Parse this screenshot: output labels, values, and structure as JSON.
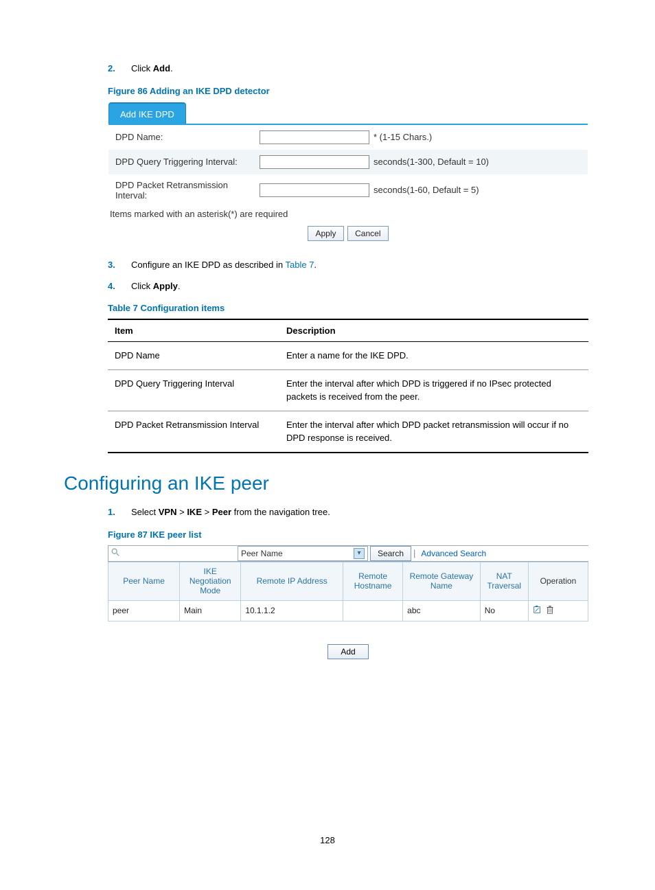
{
  "steps_a": [
    {
      "num": "2.",
      "text_pre": "Click ",
      "bold": "Add",
      "text_post": "."
    }
  ],
  "figure86": {
    "caption": "Figure 86 Adding an IKE DPD detector",
    "tab": "Add IKE DPD",
    "rows": [
      {
        "label": "DPD Name:",
        "hint": "* (1-15 Chars.)"
      },
      {
        "label": "DPD Query Triggering Interval:",
        "hint": "seconds(1-300, Default = 10)"
      },
      {
        "label": "DPD Packet Retransmission Interval:",
        "hint": "seconds(1-60, Default = 5)"
      }
    ],
    "note": "Items marked with an asterisk(*) are required",
    "apply": "Apply",
    "cancel": "Cancel"
  },
  "steps_b": [
    {
      "num": "3.",
      "text_pre": "Configure an IKE DPD as described in ",
      "link": "Table 7",
      "text_post": "."
    },
    {
      "num": "4.",
      "text_pre": "Click ",
      "bold": "Apply",
      "text_post": "."
    }
  ],
  "table7": {
    "caption": "Table 7 Configuration items",
    "col1": "Item",
    "col2": "Description",
    "rows": [
      {
        "c1": "DPD Name",
        "c2": "Enter a name for the IKE DPD."
      },
      {
        "c1": "DPD Query Triggering Interval",
        "c2": "Enter the interval after which DPD is triggered if no IPsec protected packets is received from the peer."
      },
      {
        "c1": "DPD Packet Retransmission Interval",
        "c2": "Enter the interval after which DPD packet retransmission will occur if no DPD response is received."
      }
    ]
  },
  "section_title": "Configuring an IKE peer",
  "steps_c_num": "1.",
  "steps_c_pre": "Select ",
  "steps_c_b1": "VPN",
  "steps_c_gt": " > ",
  "steps_c_b2": "IKE",
  "steps_c_b3": "Peer",
  "steps_c_post": " from the navigation tree.",
  "figure87": {
    "caption": "Figure 87 IKE peer list",
    "search_selected": "Peer Name",
    "search_btn": "Search",
    "adv": "Advanced Search",
    "headers": {
      "h1": "Peer Name",
      "h2": "IKE Negotiation Mode",
      "h3": "Remote IP Address",
      "h4": "Remote Hostname",
      "h5": "Remote Gateway Name",
      "h6": "NAT Traversal",
      "h7": "Operation"
    },
    "row": {
      "c1": "peer",
      "c2": "Main",
      "c3": "10.1.1.2",
      "c4": "",
      "c5": "abc",
      "c6": "No"
    },
    "add": "Add"
  },
  "page_number": "128"
}
